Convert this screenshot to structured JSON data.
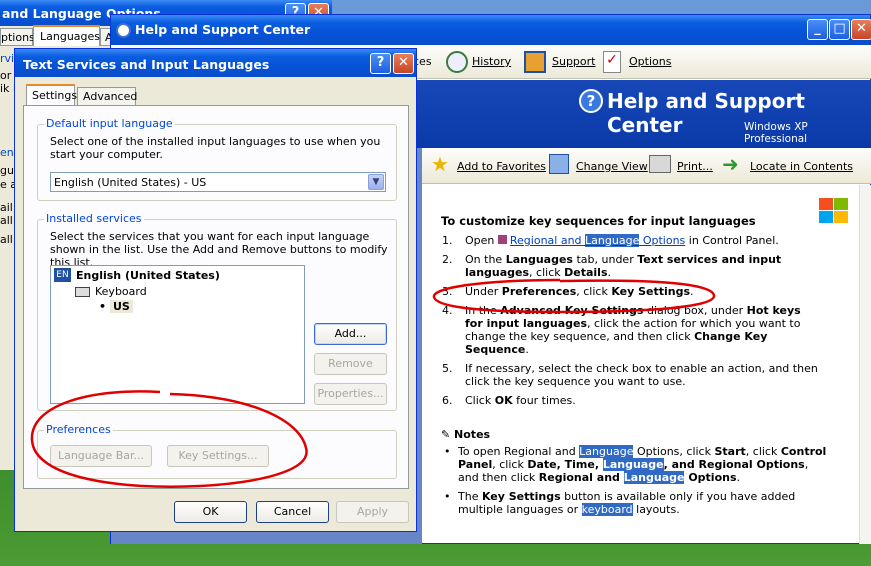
{
  "lang_options": {
    "title": "and Language Options",
    "tabs": [
      "ptions",
      "Languages",
      "A"
    ],
    "left_text": [
      "rvic",
      "or",
      "ik D",
      "ent",
      "gua",
      "e a",
      "ail)",
      "all l",
      "all l"
    ]
  },
  "help": {
    "title": "Help and Support Center",
    "toolbar": {
      "partial": "ces",
      "history": "History",
      "support": "Support",
      "options": "Options"
    },
    "banner_title": "Help and Support Center",
    "banner_sub": "Windows XP Professional",
    "actions": {
      "favorites": "Add to Favorites",
      "view": "Change View",
      "print": "Print...",
      "locate": "Locate in Contents"
    },
    "heading": "To customize key sequences for input languages",
    "steps": [
      {
        "n": "1.",
        "pre": "Open ",
        "link_a": "Regional and ",
        "link_hl": "Language",
        "link_b": " Options",
        "post": " in Control Panel."
      },
      {
        "n": "2.",
        "t1": "On the ",
        "b1": "Languages",
        "t2": " tab, under ",
        "b2": "Text services and input languages",
        "t3": ", click ",
        "b3": "Details",
        "t4": "."
      },
      {
        "n": "3.",
        "t1": "Under ",
        "b1": "Preferences",
        "t2": ", click ",
        "b2": "Key Settings",
        "t3": "."
      },
      {
        "n": "4.",
        "t1": "In the ",
        "b1": "Advanced Key Settings",
        "t2": " dialog box, under ",
        "b2": "Hot keys for input languages",
        "t3": ", click the action for which you want to change the key sequence, and then click ",
        "b3": "Change Key Sequence",
        "t4": "."
      },
      {
        "n": "5.",
        "t1": "If necessary, select the check box to enable an action, and then click the key sequence you want to use."
      },
      {
        "n": "6.",
        "t1": "Click ",
        "b1": "OK",
        "t2": " four times."
      }
    ],
    "notes_heading": "Notes",
    "note1": {
      "t1": "To open Regional and ",
      "h1": "Language",
      "t2": " Options, click ",
      "b1": "Start",
      "t3": ", click ",
      "b2": "Control Panel",
      "t4": ", click ",
      "b3": "Date, Time, ",
      "h2": "Language",
      "b4": ", and Regional Options",
      "t5": ", and then click ",
      "b5": "Regional and ",
      "h3": "Language",
      "b6": " Options",
      "t6": "."
    },
    "note2": {
      "t1": "The ",
      "b1": "Key Settings",
      "t2": " button is available only if you have added multiple languages or ",
      "h1": "keyboard",
      "t3": " layouts."
    }
  },
  "tsil": {
    "title": "Text Services and Input Languages",
    "tabs": {
      "settings": "Settings",
      "advanced": "Advanced"
    },
    "default_group": "Default input language",
    "default_desc": "Select one of the installed input languages to use when you start your computer.",
    "default_value": "English (United States) - US",
    "installed_group": "Installed services",
    "installed_desc": "Select the services that you want for each input language shown in the list. Use the Add and Remove buttons to modify this list.",
    "tree": {
      "badge": "EN",
      "lang": "English (United States)",
      "keyboard": "Keyboard",
      "layout": "US"
    },
    "buttons": {
      "add": "Add...",
      "remove": "Remove",
      "properties": "Properties..."
    },
    "pref_group": "Preferences",
    "pref_buttons": {
      "langbar": "Language Bar...",
      "keysettings": "Key Settings..."
    },
    "footer": {
      "ok": "OK",
      "cancel": "Cancel",
      "apply": "Apply"
    }
  },
  "colors": {
    "titlebar": "#0552d8",
    "annotation": "#e00000",
    "dialog_bg": "#ece9d8"
  }
}
